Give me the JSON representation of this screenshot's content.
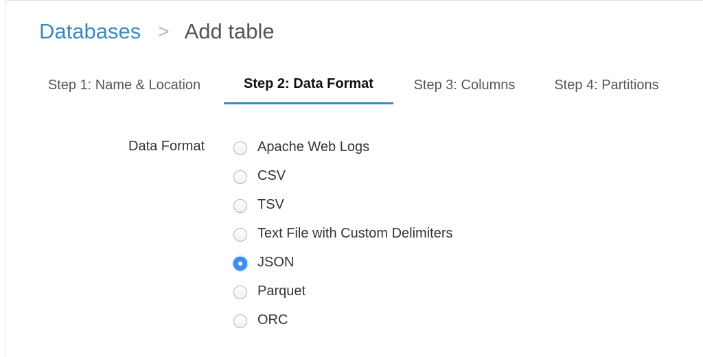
{
  "breadcrumb": {
    "parent": "Databases",
    "separator": ">",
    "current": "Add table"
  },
  "steps": [
    {
      "label": "Step 1: Name & Location",
      "active": false
    },
    {
      "label": "Step 2: Data Format",
      "active": true
    },
    {
      "label": "Step 3: Columns",
      "active": false
    },
    {
      "label": "Step 4: Partitions",
      "active": false
    }
  ],
  "data_format": {
    "label": "Data Format",
    "selected": "JSON",
    "options": [
      "Apache Web Logs",
      "CSV",
      "TSV",
      "Text File with Custom Delimiters",
      "JSON",
      "Parquet",
      "ORC"
    ]
  },
  "colors": {
    "accent": "#3a8bbb",
    "radio_selected": "#3d8ff2"
  }
}
